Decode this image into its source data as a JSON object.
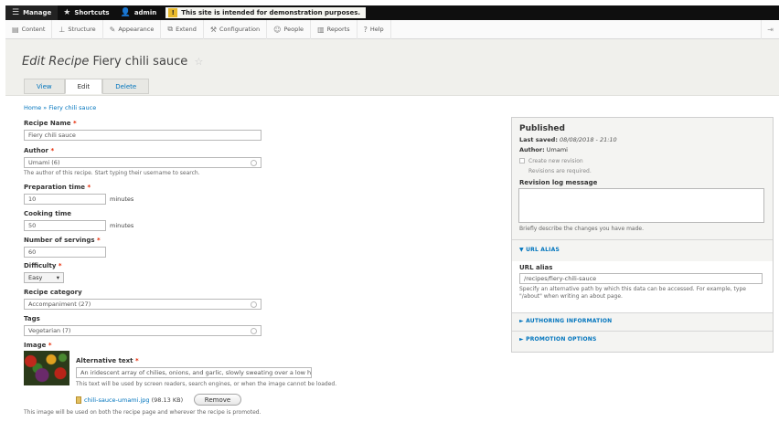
{
  "toolbar": {
    "manage": "Manage",
    "shortcuts": "Shortcuts",
    "user": "admin",
    "notice": "This site is intended for demonstration purposes."
  },
  "menu": {
    "items": [
      {
        "label": "Content",
        "icon": "file-icon"
      },
      {
        "label": "Structure",
        "icon": "structure-icon"
      },
      {
        "label": "Appearance",
        "icon": "brush-icon"
      },
      {
        "label": "Extend",
        "icon": "puzzle-icon"
      },
      {
        "label": "Configuration",
        "icon": "wrench-icon"
      },
      {
        "label": "People",
        "icon": "people-icon"
      },
      {
        "label": "Reports",
        "icon": "bar-chart-icon"
      },
      {
        "label": "Help",
        "icon": "help-icon"
      }
    ]
  },
  "page": {
    "title_prefix": "Edit Recipe",
    "title_name": "Fiery chili sauce",
    "tabs": [
      "View",
      "Edit",
      "Delete"
    ],
    "breadcrumb": "Home » Fiery chili sauce"
  },
  "form": {
    "recipe_name": {
      "label": "Recipe Name",
      "value": "Fiery chili sauce"
    },
    "author": {
      "label": "Author",
      "value": "Umami (6)",
      "description": "The author of this recipe. Start typing their username to search."
    },
    "prep_time": {
      "label": "Preparation time",
      "value": "10",
      "unit": "minutes"
    },
    "cooking_time": {
      "label": "Cooking time",
      "value": "50",
      "unit": "minutes"
    },
    "servings": {
      "label": "Number of servings",
      "value": "60"
    },
    "difficulty": {
      "label": "Difficulty",
      "value": "Easy"
    },
    "category": {
      "label": "Recipe category",
      "value": "Accompaniment (27)"
    },
    "tags": {
      "label": "Tags",
      "value": "Vegetarian (7)"
    },
    "image": {
      "label": "Image",
      "alt_label": "Alternative text",
      "alt_value": "An iridescent array of chilies, onions, and garlic, slowly sweating over a low he",
      "alt_description": "This text will be used by screen readers, search engines, or when the image cannot be loaded.",
      "file_name": "chili-sauce-umami.jpg",
      "file_size": "(98.13 KB)",
      "remove_label": "Remove",
      "description": "This image will be used on both the recipe page and wherever the recipe is promoted."
    }
  },
  "sidebar": {
    "status": "Published",
    "last_saved_label": "Last saved:",
    "last_saved_value": "08/08/2018 - 21:10",
    "author_label": "Author:",
    "author_value": "Umami",
    "new_revision": "Create new revision",
    "revisions_required": "Revisions are required.",
    "revision_log_label": "Revision log message",
    "revision_log_description": "Briefly describe the changes you have made.",
    "url_alias": {
      "heading": "▼ URL ALIAS",
      "label": "URL alias",
      "value": "/recipes/fiery-chili-sauce",
      "description_1": "Specify an alternative path by which this data can be accessed. For example, type",
      "description_2": "\"/about\" when writing an about page."
    },
    "authoring": "► AUTHORING INFORMATION",
    "promotion": "► PROMOTION OPTIONS"
  }
}
